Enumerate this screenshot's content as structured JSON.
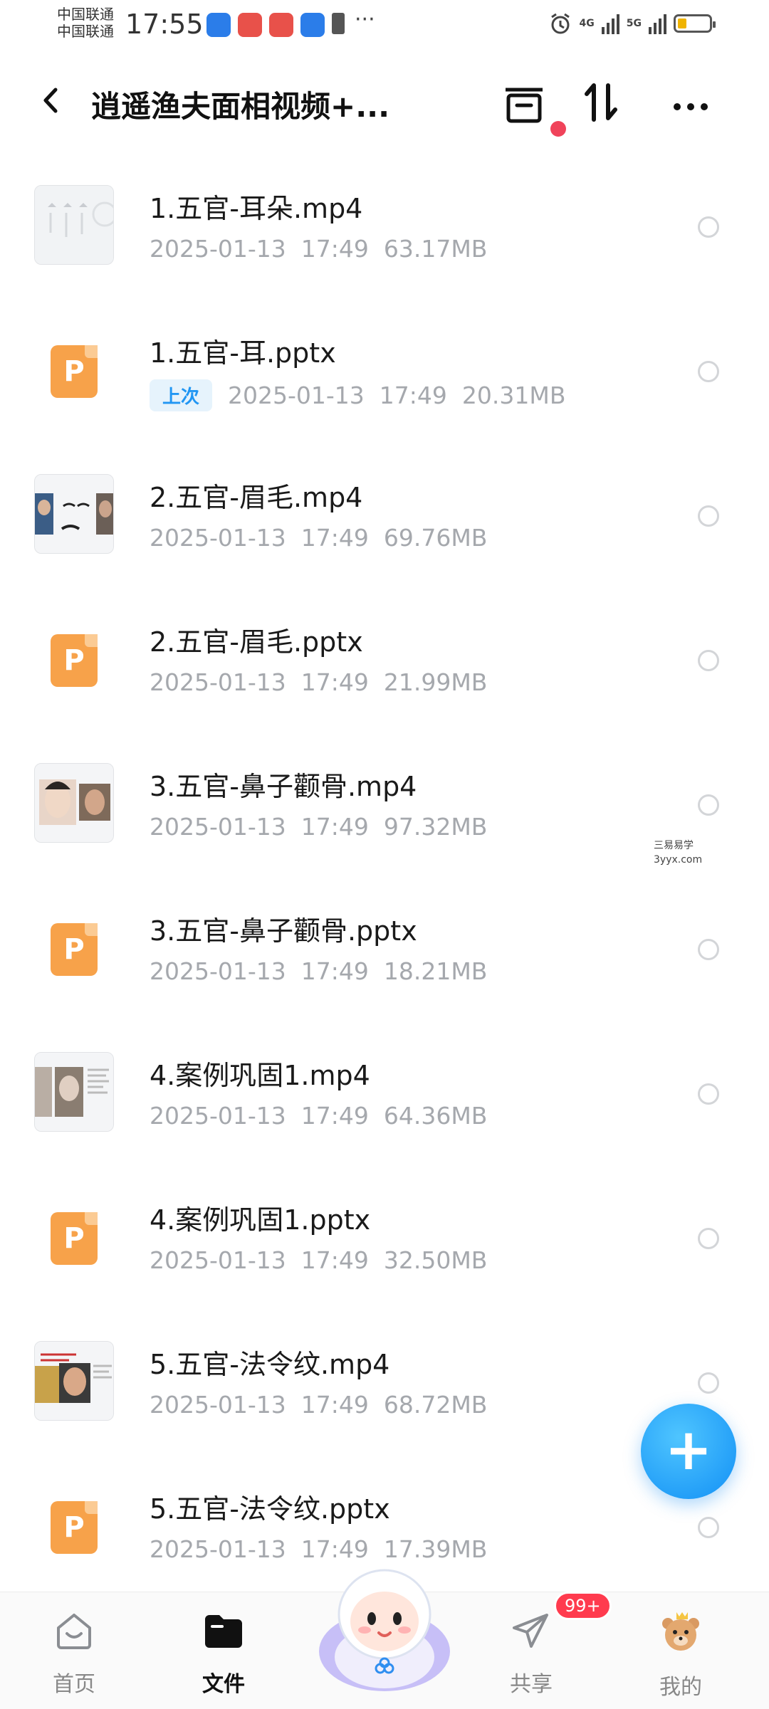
{
  "status_bar": {
    "carrier_1": "中国联通",
    "carrier_2": "中国联通",
    "time": "17:55",
    "ellipsis": "···",
    "net_1": "4G",
    "net_2": "5G"
  },
  "header": {
    "title": "逍遥渔夫面相视频+...",
    "back_icon": "chevron-left-icon",
    "actions": [
      "archive-icon",
      "sort-icon",
      "more-icon"
    ]
  },
  "files": [
    {
      "name": "1.五官-耳朵.mp4",
      "date": "2025-01-13",
      "time": "17:49",
      "size": "63.17MB",
      "type": "video",
      "tag": ""
    },
    {
      "name": "1.五官-耳.pptx",
      "date": "2025-01-13",
      "time": "17:49",
      "size": "20.31MB",
      "type": "pptx",
      "tag": "上次"
    },
    {
      "name": "2.五官-眉毛.mp4",
      "date": "2025-01-13",
      "time": "17:49",
      "size": "69.76MB",
      "type": "video",
      "tag": ""
    },
    {
      "name": "2.五官-眉毛.pptx",
      "date": "2025-01-13",
      "time": "17:49",
      "size": "21.99MB",
      "type": "pptx",
      "tag": ""
    },
    {
      "name": "3.五官-鼻子颧骨.mp4",
      "date": "2025-01-13",
      "time": "17:49",
      "size": "97.32MB",
      "type": "video",
      "tag": ""
    },
    {
      "name": "3.五官-鼻子颧骨.pptx",
      "date": "2025-01-13",
      "time": "17:49",
      "size": "18.21MB",
      "type": "pptx",
      "tag": ""
    },
    {
      "name": "4.案例巩固1.mp4",
      "date": "2025-01-13",
      "time": "17:49",
      "size": "64.36MB",
      "type": "video",
      "tag": ""
    },
    {
      "name": "4.案例巩固1.pptx",
      "date": "2025-01-13",
      "time": "17:49",
      "size": "32.50MB",
      "type": "pptx",
      "tag": ""
    },
    {
      "name": "5.五官-法令纹.mp4",
      "date": "2025-01-13",
      "time": "17:49",
      "size": "68.72MB",
      "type": "video",
      "tag": ""
    },
    {
      "name": "5.五官-法令纹.pptx",
      "date": "2025-01-13",
      "time": "17:49",
      "size": "17.39MB",
      "type": "pptx",
      "tag": ""
    }
  ],
  "pptx_glyph": "P",
  "watermark": {
    "line1": "三易易学",
    "line2": "3yyx.com"
  },
  "fab": {
    "label": "+"
  },
  "nav": {
    "items": [
      {
        "label": "首页",
        "icon": "home-icon"
      },
      {
        "label": "文件",
        "icon": "folder-icon"
      },
      {
        "label": "",
        "icon": "mascot-icon"
      },
      {
        "label": "共享",
        "icon": "paper-plane-icon"
      },
      {
        "label": "我的",
        "icon": "bear-avatar-icon"
      }
    ],
    "share_badge": "99+"
  },
  "colors": {
    "accent": "#1290f5",
    "pptx": "#f7a24a",
    "tag": "#2196f3",
    "badge": "#ff3b4e"
  }
}
